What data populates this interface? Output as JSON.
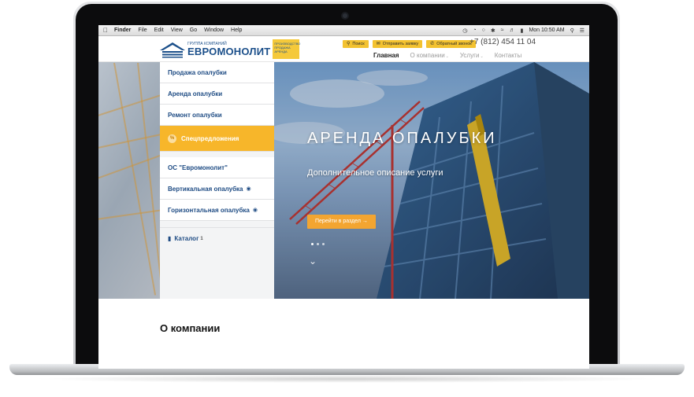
{
  "menubar": {
    "apple": "",
    "items": [
      "Finder",
      "File",
      "Edit",
      "View",
      "Go",
      "Window",
      "Help"
    ],
    "clock": "Mon 10:50 AM"
  },
  "header": {
    "logo_sub": "ГРУППА КОМПАНИЙ",
    "logo_main": "ЕВРОМОНОЛИТ",
    "logo_tag": "ПРОИЗВОДСТВО ПРОДАЖА АРЕНДА",
    "actions": [
      {
        "label": "Поиск",
        "icon": "search-icon"
      },
      {
        "label": "Отправить заявку",
        "icon": "mail-icon"
      },
      {
        "label": "Обратный звонок",
        "icon": "phone-icon"
      }
    ],
    "phone": "+7 (812) 454 11 04",
    "nav": [
      {
        "label": "Главная",
        "active": true
      },
      {
        "label": "О компании",
        "dropdown": true
      },
      {
        "label": "Услуги",
        "dropdown": true
      },
      {
        "label": "Контакты"
      }
    ]
  },
  "sidebar": {
    "group1": [
      "Продажа опалубки",
      "Аренда опалубки",
      "Ремонт опалубки"
    ],
    "special": "Спецпредложения",
    "special_icon": "%",
    "group2": [
      "ОС \"Евромонолит\"",
      "Вертикальная опалубка",
      "Горизонтальная опалубка"
    ],
    "catalog": "Каталог",
    "catalog_sup": "1"
  },
  "hero": {
    "title": "АРЕНДА ОПАЛУБКИ",
    "description": "Дополнительное описание услуги",
    "button": "Перейти в раздел →"
  },
  "section_title": "О компании",
  "colors": {
    "brand_blue": "#1f4c84",
    "accent_yellow": "#f7b62a",
    "button_orange": "#f3a531"
  }
}
